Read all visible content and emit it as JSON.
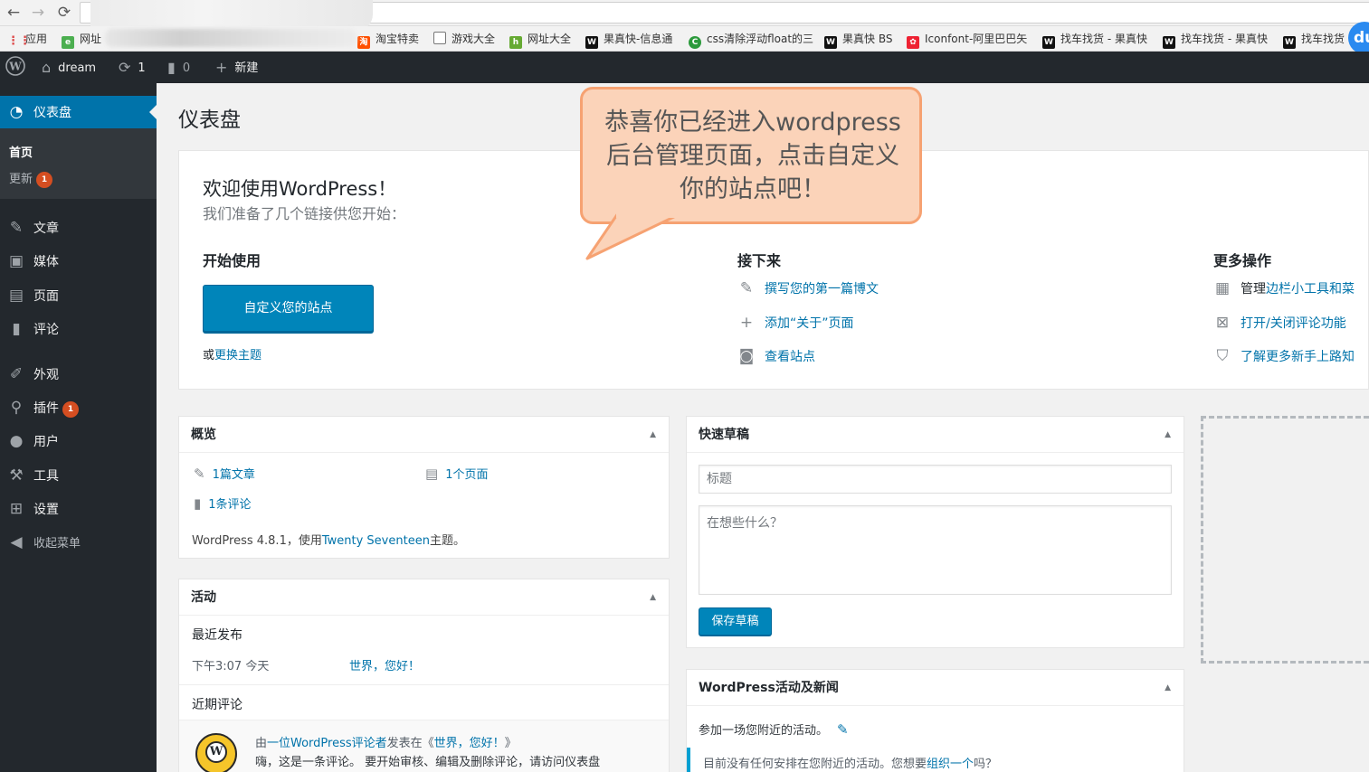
{
  "browser": {
    "back": "←",
    "forward": "→",
    "reload": "⟳",
    "bookmarks": [
      {
        "label": "应用",
        "icon": "apps-grid-icon"
      },
      {
        "label": "网址",
        "icon": "bookmark-green-icon"
      },
      {
        "label": "淘宝特卖",
        "icon": "taobao-icon"
      },
      {
        "label": "游戏大全",
        "icon": "page-icon"
      },
      {
        "label": "网址大全",
        "icon": "hao-icon"
      },
      {
        "label": "果真快-信息通",
        "icon": "ws-icon"
      },
      {
        "label": "css清除浮动float的三",
        "icon": "c-green-icon"
      },
      {
        "label": "果真快 BS",
        "icon": "ws-icon"
      },
      {
        "label": "Iconfont-阿里巴巴矢",
        "icon": "iconfont-icon"
      },
      {
        "label": "找车找货 - 果真快",
        "icon": "ws-icon"
      },
      {
        "label": "找车找货 - 果真快",
        "icon": "ws-icon"
      },
      {
        "label": "找车找货",
        "icon": "ws-icon"
      }
    ],
    "du": "du"
  },
  "adminbar": {
    "site_name": "dream",
    "updates_count": "1",
    "comments_count": "0",
    "new_label": "新建"
  },
  "sidebar": {
    "current": "仪表盘",
    "sub": [
      {
        "label": "首页"
      },
      {
        "label": "更新",
        "badge": "1"
      }
    ],
    "items": [
      {
        "label": "文章",
        "icon": "pin-icon"
      },
      {
        "label": "媒体",
        "icon": "media-icon"
      },
      {
        "label": "页面",
        "icon": "page-icon"
      },
      {
        "label": "评论",
        "icon": "comment-icon"
      },
      {
        "label": "外观",
        "icon": "brush-icon"
      },
      {
        "label": "插件",
        "icon": "plugin-icon",
        "badge": "1"
      },
      {
        "label": "用户",
        "icon": "user-icon"
      },
      {
        "label": "工具",
        "icon": "wrench-icon"
      },
      {
        "label": "设置",
        "icon": "settings-icon"
      },
      {
        "label": "收起菜单",
        "icon": "collapse-icon"
      }
    ]
  },
  "page_title": "仪表盘",
  "welcome": {
    "title": "欢迎使用WordPress！",
    "about": "我们准备了几个链接供您开始：",
    "get_started": "开始使用",
    "customize_button": "自定义您的站点",
    "or_text": "或",
    "change_theme": "更换主题",
    "next_steps": "接下来",
    "next_items": [
      "撰写您的第一篇博文",
      "添加“关于”页面",
      "查看站点"
    ],
    "more_actions": "更多操作",
    "more_items": [
      {
        "prefix": "管理",
        "link": "边栏小工具和菜"
      },
      {
        "prefix": "",
        "link": "打开/关闭评论功能"
      },
      {
        "prefix": "",
        "link": "了解更多新手上路知"
      }
    ]
  },
  "at_a_glance": {
    "title": "概览",
    "posts": "1篇文章",
    "pages": "1个页面",
    "comments": "1条评论",
    "version_prefix": "WordPress 4.8.1，使用",
    "theme": "Twenty Seventeen",
    "version_suffix": "主题。"
  },
  "activity": {
    "title": "活动",
    "recent_published": "最近发布",
    "time": "下午3:07 今天",
    "post_link": "世界，您好！",
    "recent_comments": "近期评论",
    "comment_from": "由",
    "commenter": "一位WordPress评论者",
    "comment_on": "发表在《",
    "comment_post": "世界，您好！",
    "comment_end": "》",
    "comment_text": "嗨，这是一条评论。 要开始审核、编辑及删除评论，请访问仪表盘"
  },
  "quick_draft": {
    "title": "快速草稿",
    "title_placeholder": "标题",
    "content_placeholder": "在想些什么？",
    "save_button": "保存草稿"
  },
  "news": {
    "title": "WordPress活动及新闻",
    "attend": "参加一场您附近的活动。",
    "no_events_prefix": "目前没有任何安排在您附近的活动。您想要",
    "organize_link": "组织一个",
    "no_events_suffix": "吗？"
  },
  "bubble": {
    "text": "恭喜你已经进入wordpress后台管理页面，点击自定义你的站点吧！"
  },
  "colors": {
    "adminbar": "#23282d",
    "accent": "#0073aa",
    "button": "#0085ba",
    "badge": "#d54e21",
    "bubble_fill": "#fbd3b9",
    "bubble_border": "#f6a272"
  }
}
